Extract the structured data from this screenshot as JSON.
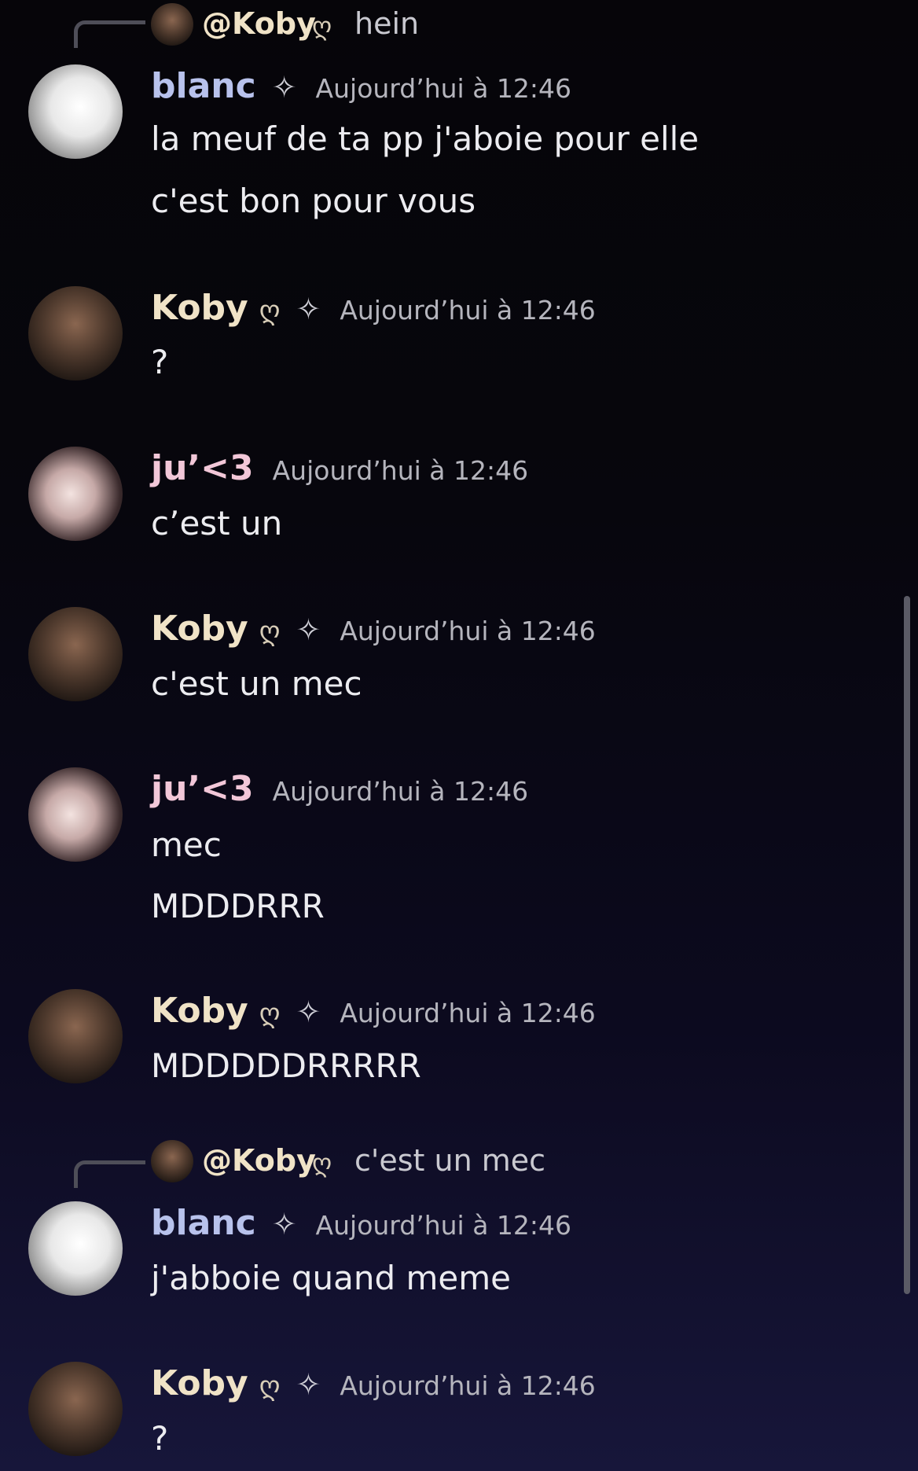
{
  "colors": {
    "blanc": "#b8c2ec",
    "koby": "#f0e3c7",
    "ju": "#f2c7d8",
    "timestamp": "#b5b5bd",
    "background": "#07060d"
  },
  "icons": {
    "badge": "heart-loop-icon",
    "spark": "sparkle-icon"
  },
  "reply1": {
    "mention": "@Koby",
    "text": "hein"
  },
  "m1": {
    "username": "blanc",
    "time": "Aujourd’hui à 12:46",
    "lines": [
      "la meuf de ta pp j'aboie pour elle",
      "c'est bon pour vous"
    ]
  },
  "m2": {
    "username": "Koby",
    "time": "Aujourd’hui à 12:46",
    "lines": [
      "?"
    ]
  },
  "m3": {
    "username": "ju’<3",
    "time": "Aujourd’hui à 12:46",
    "lines": [
      "c’est un"
    ]
  },
  "m4": {
    "username": "Koby",
    "time": "Aujourd’hui à 12:46",
    "lines": [
      "c'est un mec"
    ]
  },
  "m5": {
    "username": "ju’<3",
    "time": "Aujourd’hui à 12:46",
    "lines": [
      "mec",
      "MDDDRRR"
    ]
  },
  "m6": {
    "username": "Koby",
    "time": "Aujourd’hui à 12:46",
    "lines": [
      "MDDDDDRRRRR"
    ]
  },
  "reply2": {
    "mention": "@Koby",
    "text": "c'est un mec"
  },
  "m7": {
    "username": "blanc",
    "time": "Aujourd’hui à 12:46",
    "lines": [
      "j'abboie quand meme"
    ]
  },
  "m8": {
    "username": "Koby",
    "time": "Aujourd’hui à 12:46",
    "lines": [
      "?"
    ]
  }
}
